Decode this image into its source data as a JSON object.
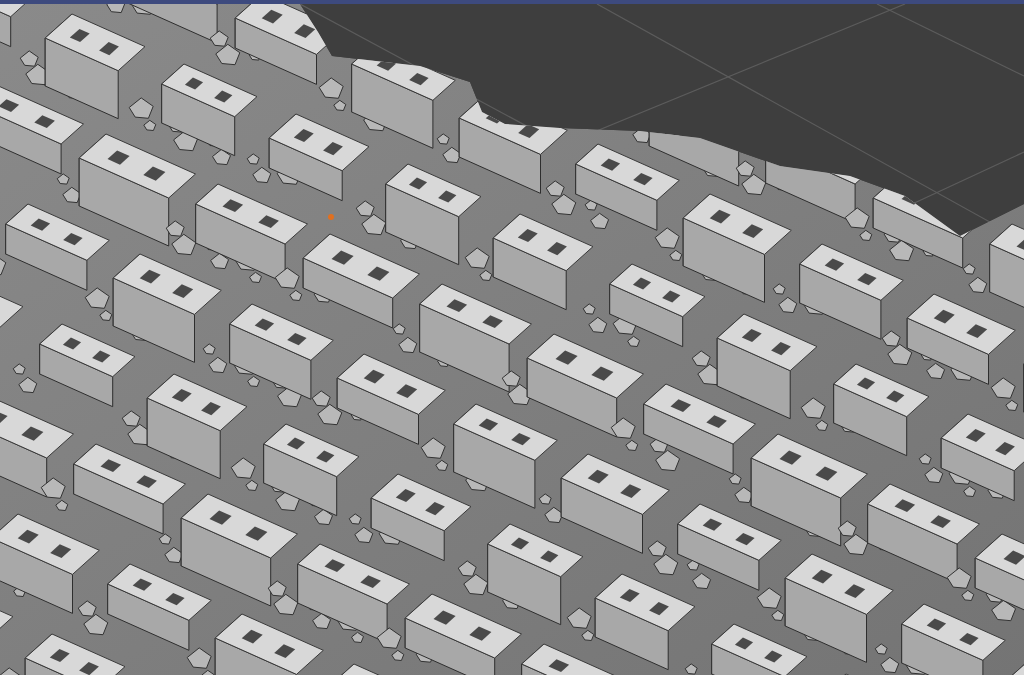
{
  "viewport": {
    "kind": "mesh",
    "grid": true
  }
}
